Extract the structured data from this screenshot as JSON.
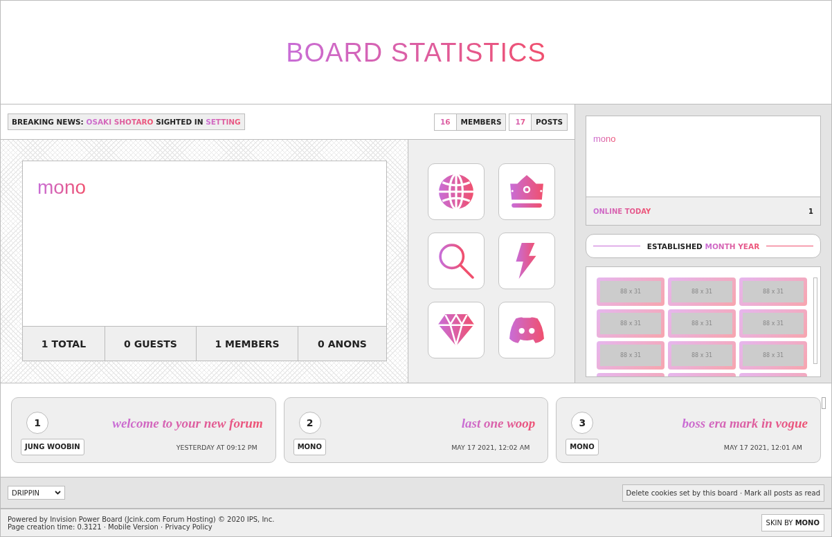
{
  "header": {
    "title": "BOARD STATISTICS"
  },
  "news": {
    "label": "BREAKING NEWS:",
    "name": "OSAKI SHOTARO",
    "middle": "SIGHTED IN",
    "place": "SETTING"
  },
  "counters": [
    {
      "value": "16",
      "label": "MEMBERS"
    },
    {
      "value": "17",
      "label": "POSTS"
    }
  ],
  "online_box": {
    "names": "mono",
    "stats": [
      "1 TOTAL",
      "0 GUESTS",
      "1 MEMBERS",
      "0 ANONS"
    ]
  },
  "quick_links": [
    {
      "kind": "globe"
    },
    {
      "kind": "crown"
    },
    {
      "kind": "search"
    },
    {
      "kind": "bolt"
    },
    {
      "kind": "gem"
    },
    {
      "kind": "discord"
    }
  ],
  "sidebar": {
    "names": "mono",
    "online_today_label": "ONLINE TODAY",
    "online_today_count": "1",
    "established": "ESTABLISHED",
    "established_date": "MONTH YEAR",
    "affiliates": [
      "88 x 31",
      "88 x 31",
      "88 x 31",
      "88 x 31",
      "88 x 31",
      "88 x 31",
      "88 x 31",
      "88 x 31",
      "88 x 31"
    ]
  },
  "recent_topics": [
    {
      "number": "1",
      "title": "welcome to your new forum",
      "author": "JUNG WOOBIN",
      "date": "YESTERDAY AT 09:12 PM"
    },
    {
      "number": "2",
      "title": "last one woop",
      "author": "MONO",
      "date": "MAY 17 2021, 12:02 AM"
    },
    {
      "number": "3",
      "title": "boss era mark in vogue",
      "author": "MONO",
      "date": "MAY 17 2021, 12:01 AM"
    }
  ],
  "footer": {
    "skin_select": "DRIPPIN",
    "links": [
      "Delete cookies set by this board",
      "Mark all posts as read"
    ],
    "separator": "·",
    "powered_by": "Powered by Invision Power Board (Jcink.com Forum Hosting) © 2020  IPS, Inc.",
    "creation_time": "Page creation time: 0.3121",
    "bottom_links": [
      "Mobile Version",
      "Privacy Policy"
    ],
    "skin_credit": "SKIN BY",
    "skin_author": "MONO"
  }
}
